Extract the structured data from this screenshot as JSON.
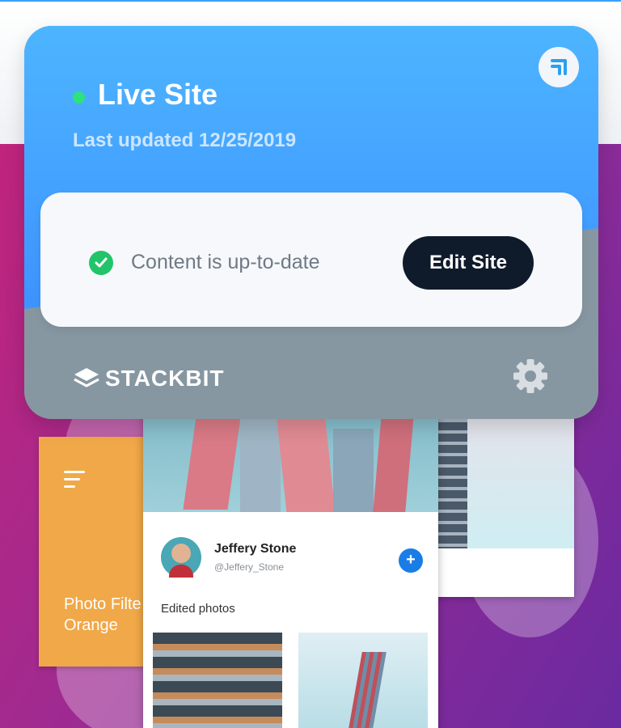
{
  "widget": {
    "title": "Live Site",
    "last_updated": "Last updated 12/25/2019",
    "status_text": "Content is up-to-date",
    "edit_button_label": "Edit Site",
    "brand": "STACKBIT",
    "live_status_color": "#2be37a",
    "header_color": "#3d92ff",
    "footer_color": "#8797a1",
    "corner_icon": "collapse-corner-icon",
    "status_icon": "check-circle-icon",
    "settings_icon": "gear-icon"
  },
  "background_preview": {
    "orange_card_caption_line1": "Photo Filte",
    "orange_card_caption_line2": "Orange",
    "profile_name": "Jeffery Stone",
    "profile_handle": "@Jeffery_Stone",
    "add_button_label": "+",
    "section_label": "Edited photos"
  }
}
